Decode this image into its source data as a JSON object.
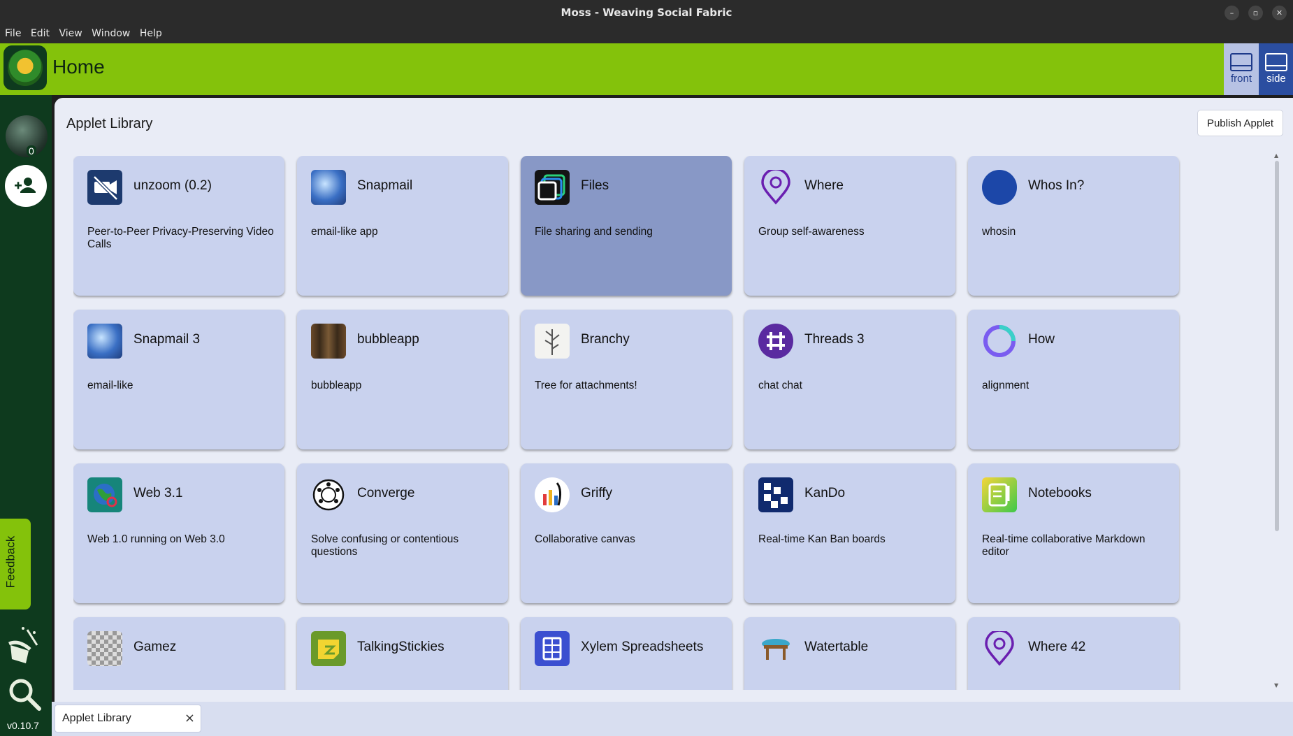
{
  "window": {
    "title": "Moss - Weaving Social Fabric",
    "minimize_symbol": "–",
    "restore_symbol": "▫",
    "close_symbol": "✕"
  },
  "menu": [
    "File",
    "Edit",
    "View",
    "Window",
    "Help"
  ],
  "header": {
    "title": "Home",
    "front_label": "front",
    "side_label": "side"
  },
  "sidebar": {
    "avatar_count": "0",
    "feedback_label": "Feedback",
    "version": "v0.10.7"
  },
  "main": {
    "title": "Applet Library",
    "publish_label": "Publish Applet"
  },
  "applets": [
    {
      "name": "unzoom (0.2)",
      "desc": "Peer-to-Peer Privacy-Preserving Video Calls",
      "icon": "video-off-icon"
    },
    {
      "name": "Snapmail",
      "desc": "email-like app",
      "icon": "snapmail-icon"
    },
    {
      "name": "Files",
      "desc": "File sharing and sending",
      "icon": "files-icon"
    },
    {
      "name": "Where",
      "desc": "Group self-awareness",
      "icon": "location-pin-icon"
    },
    {
      "name": "Whos In?",
      "desc": "whosin",
      "icon": "whos-in-icon"
    },
    {
      "name": "Snapmail 3",
      "desc": "email-like",
      "icon": "snapmail-icon"
    },
    {
      "name": "bubbleapp",
      "desc": "bubbleapp",
      "icon": "bubbleapp-icon"
    },
    {
      "name": "Branchy",
      "desc": "Tree for attachments!",
      "icon": "branch-icon"
    },
    {
      "name": "Threads 3",
      "desc": "chat chat",
      "icon": "threads-icon"
    },
    {
      "name": "How",
      "desc": "alignment",
      "icon": "ring-icon"
    },
    {
      "name": "Web 3.1",
      "desc": "Web 1.0 running on Web 3.0",
      "icon": "globe-icon"
    },
    {
      "name": "Converge",
      "desc": "Solve confusing or contentious questions",
      "icon": "converge-icon"
    },
    {
      "name": "Griffy",
      "desc": "Collaborative canvas",
      "icon": "paint-icon"
    },
    {
      "name": "KanDo",
      "desc": "Real-time Kan Ban boards",
      "icon": "kanban-icon"
    },
    {
      "name": "Notebooks",
      "desc": "Real-time collaborative Markdown editor",
      "icon": "notebook-icon"
    },
    {
      "name": "Gamez",
      "desc": "",
      "icon": "checker-icon"
    },
    {
      "name": "TalkingStickies",
      "desc": "",
      "icon": "sticky-note-icon"
    },
    {
      "name": "Xylem Spreadsheets",
      "desc": "",
      "icon": "spreadsheet-icon"
    },
    {
      "name": "Watertable",
      "desc": "",
      "icon": "table-icon"
    },
    {
      "name": "Where 42",
      "desc": "",
      "icon": "location-pin-icon"
    }
  ],
  "bottom_tab": {
    "label": "Applet Library",
    "close_symbol": "×"
  }
}
